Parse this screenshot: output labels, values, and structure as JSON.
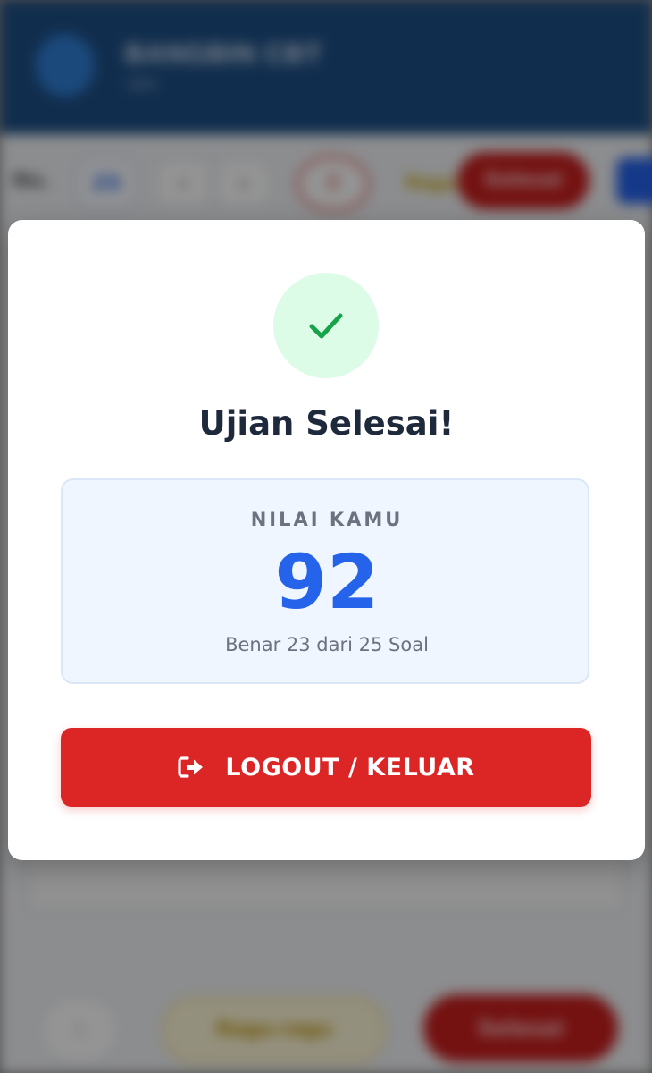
{
  "background": {
    "app_title": "BANGBIN CBT",
    "app_subtitle": "ujian",
    "toolbar": {
      "no_label": "No.",
      "current_number": "25",
      "nav_prev": "‹",
      "nav_next": "›",
      "timer": "0",
      "ragu_label": "Ragu",
      "finish_label": "Selesai"
    },
    "bottom": {
      "prev_label": "‹",
      "ragu_label": "Ragu-ragu",
      "next_label": "Selesai"
    }
  },
  "modal": {
    "icon": "check-icon",
    "title": "Ujian Selesai!",
    "score": {
      "label": "NILAI KAMU",
      "value": "92",
      "detail": "Benar 23 dari 25 Soal"
    },
    "logout_button": {
      "icon": "logout-icon",
      "label": "LOGOUT / KELUAR"
    }
  },
  "colors": {
    "success_bg": "#dcfce7",
    "success_check": "#16a34a",
    "score_blue": "#2563eb",
    "danger_red": "#dc2626",
    "header_blue": "#1e4f86"
  }
}
